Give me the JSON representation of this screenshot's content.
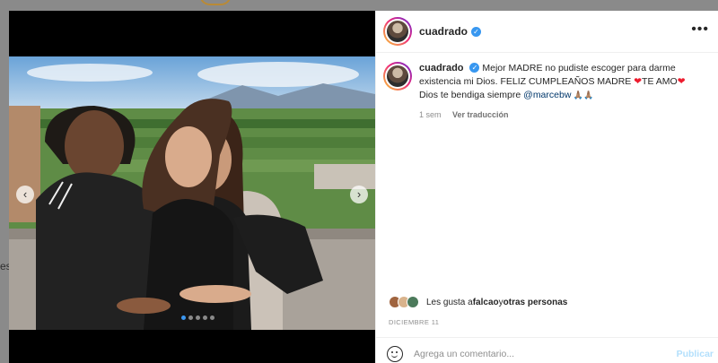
{
  "backdrop": {
    "fragment": "es"
  },
  "post": {
    "username": "cuadrado",
    "verified_symbol": "✓",
    "more_symbol": "•••",
    "caption": {
      "text_before_heart1": "Mejor MADRE no pudiste escoger para darme existencia mi Dios. FELIZ CUMPLEAÑOS MADRE ",
      "heart1": "❤",
      "text_te_amo": "TE AMO",
      "heart2": "❤",
      "text_blessing": "Dios te bendiga siempre ",
      "mention": "@marcebw",
      "emojis": " 🙏🏽🙏🏽"
    },
    "time_ago": "1 sem",
    "translate_label": "Ver traducción",
    "likes": {
      "prefix": "Les gusta a ",
      "user": "falcao",
      "connector": " y ",
      "others": "otras personas"
    },
    "date": "DICIEMBRE 11",
    "comment": {
      "placeholder": "Agrega un comentario...",
      "publish_label": "Publicar"
    },
    "carousel": {
      "total_slides": 5,
      "active_index": 0,
      "prev_symbol": "‹",
      "next_symbol": "›"
    }
  },
  "colors": {
    "verified": "#3897f0",
    "heart": "#ed1c2e",
    "mention": "#00376b",
    "publish_disabled": "#b2dffc",
    "active_dot": "#3b97f0"
  }
}
